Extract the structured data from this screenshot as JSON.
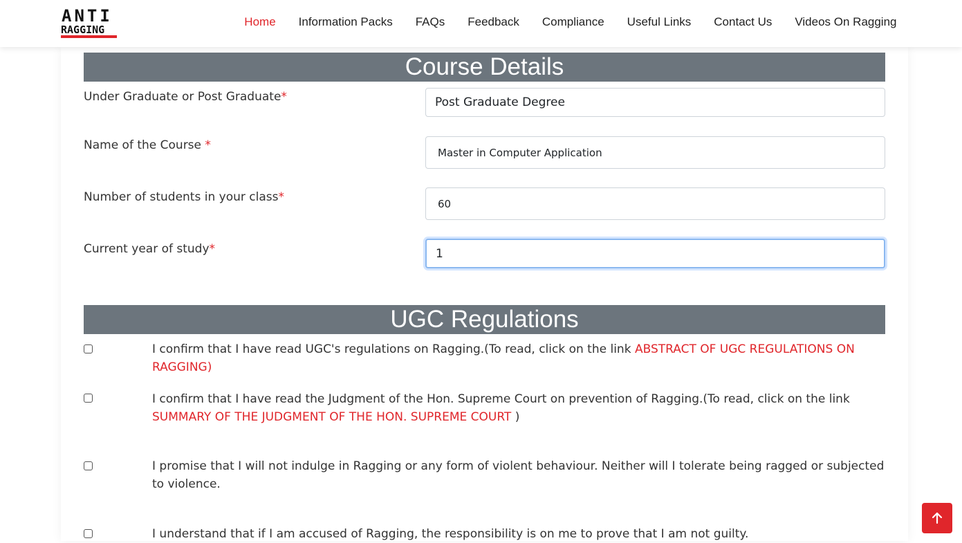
{
  "brand": {
    "logo_line1": "ANTI",
    "logo_line2": "RAGGING"
  },
  "nav": {
    "items": [
      {
        "label": "Home",
        "active": true
      },
      {
        "label": "Information Packs"
      },
      {
        "label": "FAQs"
      },
      {
        "label": "Feedback"
      },
      {
        "label": "Compliance"
      },
      {
        "label": "Useful Links"
      },
      {
        "label": "Contact Us"
      },
      {
        "label": "Videos On Ragging"
      }
    ]
  },
  "course": {
    "title": "Course Details",
    "fields": [
      {
        "label": "Under Graduate or Post Graduate",
        "required": "*",
        "value": "Post Graduate Degree"
      },
      {
        "label": "Name of the Course ",
        "required": "*",
        "value": "Master in Computer Application"
      },
      {
        "label": "Number of students in your class",
        "required": "*",
        "value": "60"
      },
      {
        "label": "Current year of study",
        "required": "*",
        "value": "1"
      }
    ]
  },
  "ugc": {
    "title": "UGC Regulations",
    "items": [
      {
        "text": "I confirm that I have read UGC's regulations on Ragging.(To read, click on the link ",
        "link": "ABSTRACT OF UGC REGULATIONS ON RAGGING)",
        "tail": ""
      },
      {
        "text": "I confirm that I have read the Judgment of the Hon. Supreme Court on prevention of Ragging.(To read, click on the link ",
        "link": "SUMMARY OF THE JUDGMENT OF THE HON. SUPREME COURT",
        "tail": " )"
      },
      {
        "text": "I promise that I will not indulge in Ragging or any form of violent behaviour. Neither will I tolerate being ragged or subjected to violence."
      },
      {
        "text": "I understand that if I am accused of Ragging, the responsibility is on me to prove that I am not guilty."
      }
    ]
  },
  "colors": {
    "accent": "#e0262b",
    "section_header": "#6c757d",
    "focus_border": "#8bb8f0"
  },
  "icons": {
    "scroll_top": "arrow-up-icon"
  }
}
